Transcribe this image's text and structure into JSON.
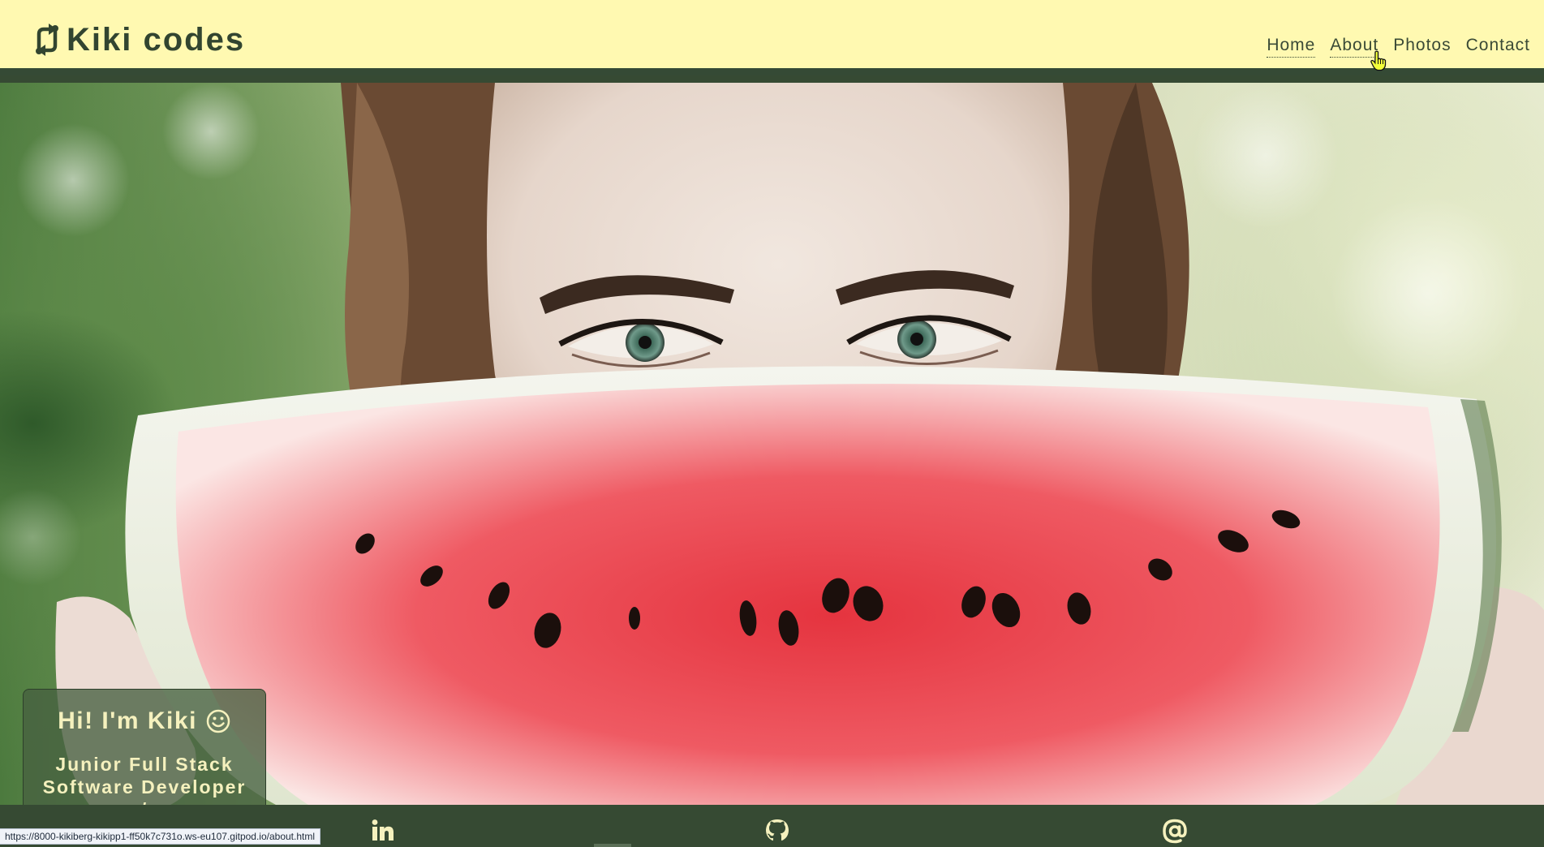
{
  "header": {
    "brand_name": "Kiki codes",
    "brand_icon": "arrows-rotate-icon",
    "nav": [
      {
        "label": "Home"
      },
      {
        "label": "About"
      },
      {
        "label": "Photos"
      },
      {
        "label": "Contact"
      }
    ]
  },
  "hero": {
    "image": "woman-holding-watermelon-slice-photo",
    "intro_title": "Hi! I'm Kiki",
    "intro_icon": "smiley-face-icon",
    "intro_subtitle": "Junior Full Stack Software Developer </>"
  },
  "footer": {
    "social": [
      {
        "icon": "linkedin-icon"
      },
      {
        "icon": "github-icon"
      },
      {
        "icon": "at-sign-icon"
      }
    ]
  },
  "status_bar": {
    "url": "https://8000-kikiberg-kikipp1-ff50k7c731o.ws-eu107.gitpod.io/about.html"
  },
  "colors": {
    "header_bg": "#fff9b1",
    "dark_green": "#364a33",
    "card_text": "#f5f1be",
    "card_bg": "rgba(70,96,64,0.78)"
  }
}
